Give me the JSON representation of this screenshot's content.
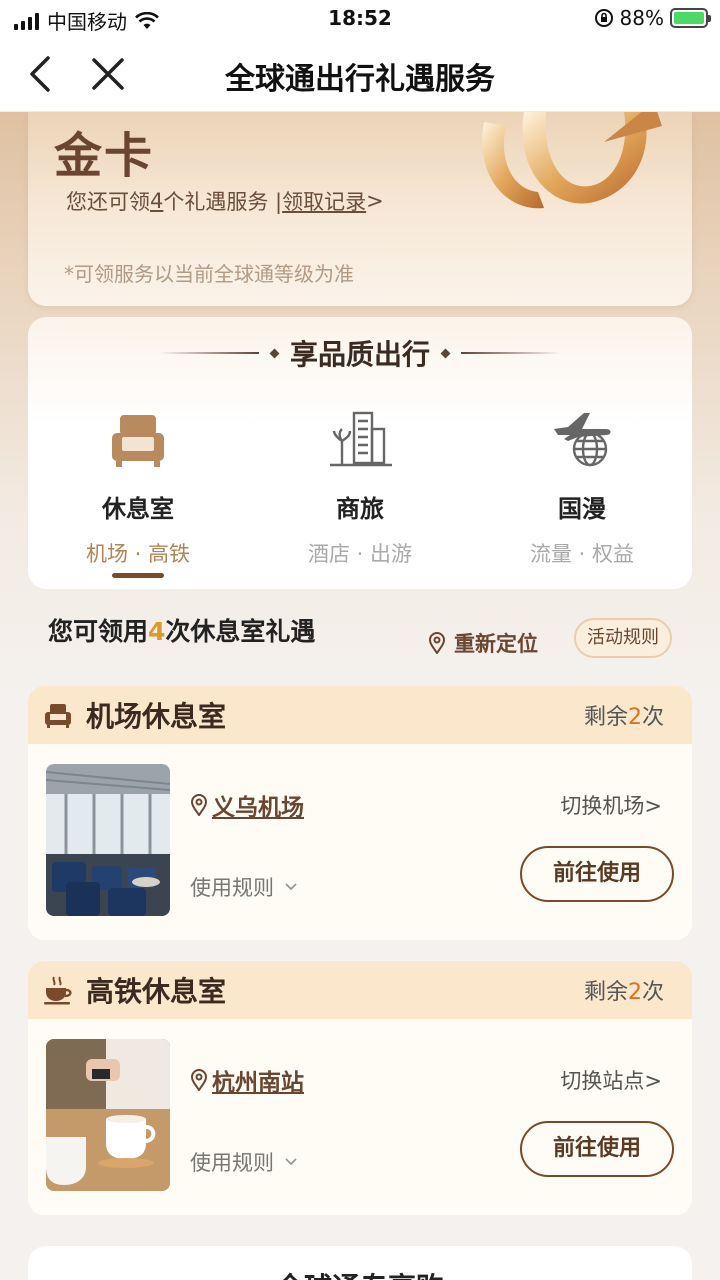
{
  "status": {
    "carrier": "中国移动",
    "time": "18:52",
    "battery": "88%"
  },
  "nav": {
    "title": "全球通出行礼遇服务"
  },
  "gold": {
    "title": "金卡",
    "sub_prefix": "您还可领",
    "sub_count": "4",
    "sub_suffix": "个礼遇服务 | ",
    "record_link": "领取记录",
    "record_arrow": ">",
    "note": "*可领服务以当前全球通等级为准"
  },
  "panel": {
    "title": "享品质出行",
    "categories": [
      {
        "name": "休息室",
        "sub": "机场 · 高铁",
        "icon": "sofa-icon"
      },
      {
        "name": "商旅",
        "sub": "酒店 · 出游",
        "icon": "buildings-icon"
      },
      {
        "name": "国漫",
        "sub": "流量 · 权益",
        "icon": "plane-globe-icon"
      }
    ]
  },
  "count": {
    "prefix": "您可领用",
    "n": "4",
    "suffix": "次休息室礼遇"
  },
  "relocate_label": "重新定位",
  "rules_label": "活动规则",
  "lounges": [
    {
      "title": "机场休息室",
      "remain_prefix": "剩余",
      "remain_n": "2",
      "remain_suffix": "次",
      "location": "义乌机场",
      "switch": "切换机场>",
      "rules": "使用规则",
      "go": "前往使用"
    },
    {
      "title": "高铁休息室",
      "remain_prefix": "剩余",
      "remain_n": "2",
      "remain_suffix": "次",
      "location": "杭州南站",
      "switch": "切换站点>",
      "rules": "使用规则",
      "go": "前往使用"
    }
  ],
  "bottom": {
    "title": "全球通专享购"
  }
}
